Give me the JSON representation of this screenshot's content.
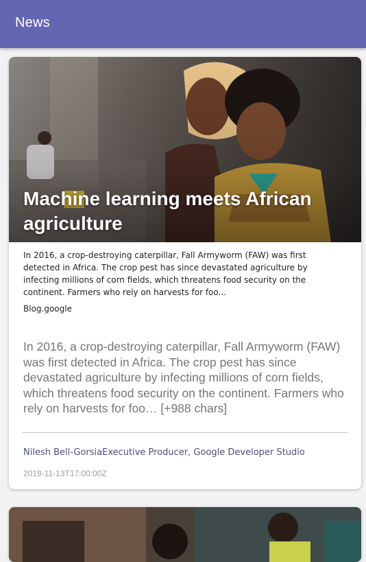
{
  "app": {
    "title": "News"
  },
  "articles": [
    {
      "title": "Machine learning meets African agriculture",
      "description": "In 2016, a crop-destroying caterpillar, Fall Armyworm (FAW) was first detected in Africa. The crop pest has since devastated agriculture by infecting millions of corn fields, which threatens food security on the continent. Farmers who rely on harvests for foo...",
      "source": "Blog.google",
      "content": "In 2016, a crop-destroying caterpillar, Fall Armyworm (FAW) was first detected in Africa. The crop pest has since devastated agriculture by infecting millions of corn fields, which threatens food security on the continent. Farmers who rely on harvests for foo… [+988 chars]",
      "author": "Nilesh Bell-GorsiaExecutive Producer, Google Developer Studio",
      "published_at": "2019-11-13T17:00:00Z"
    }
  ],
  "colors": {
    "appbar": "#6366b0",
    "card": "#ffffff",
    "background": "#f2f2f2"
  }
}
